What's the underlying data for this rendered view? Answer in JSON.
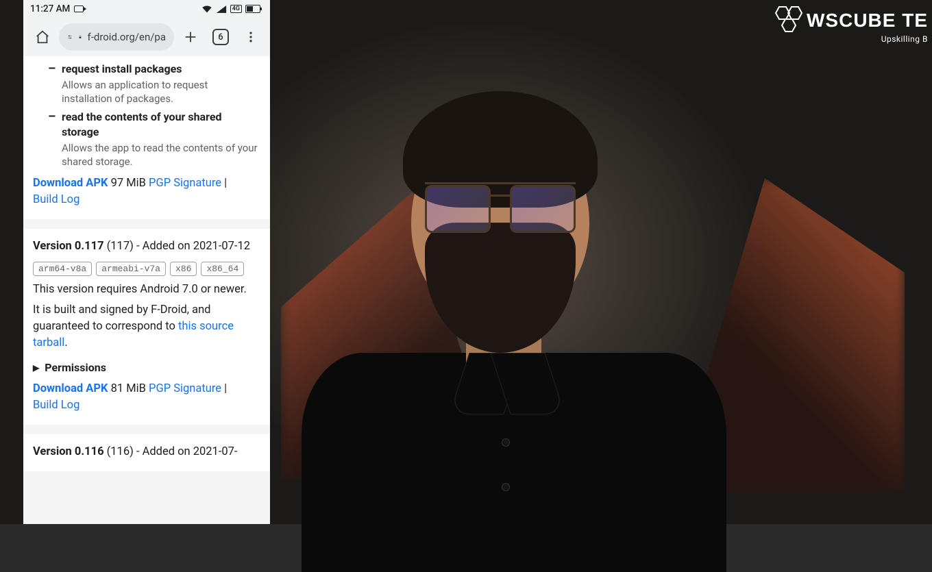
{
  "watermark": {
    "brand": "WSCUBE TE",
    "sub": "Upskilling B"
  },
  "statusbar": {
    "time": "11:27 AM",
    "network_label": "4G",
    "battery_pct": 46
  },
  "browser": {
    "url_display": "f-droid.org/en/pa",
    "tab_count": "6"
  },
  "page": {
    "card1": {
      "perm1": {
        "title": "request install packages",
        "desc": "Allows an application to request installation of packages."
      },
      "perm2": {
        "title": "read the contents of your shared storage",
        "desc": "Allows the app to read the contents of your shared storage."
      },
      "download_label": "Download APK",
      "size": "97 MiB",
      "pgp_label": "PGP Signature",
      "sep": " | ",
      "buildlog_label": "Build Log"
    },
    "card2": {
      "ver_strong": "Version 0.117",
      "ver_rest": " (117) - Added on 2021-07-12",
      "arch": [
        "arm64-v8a",
        "armeabi-v7a",
        "x86",
        "x86_64"
      ],
      "req_text": "This version requires Android 7.0 or newer.",
      "signed_pre": "It is built and signed by F-Droid, and guaranteed to correspond to ",
      "signed_link": "this source tarball",
      "signed_post": ".",
      "permissions_label": "Permissions",
      "download_label": "Download APK",
      "size": "81 MiB",
      "pgp_label": "PGP Signature",
      "sep": " | ",
      "buildlog_label": "Build Log"
    },
    "card3": {
      "ver_strong": "Version 0.116",
      "ver_rest": " (116) - Added on 2021-07-"
    }
  }
}
